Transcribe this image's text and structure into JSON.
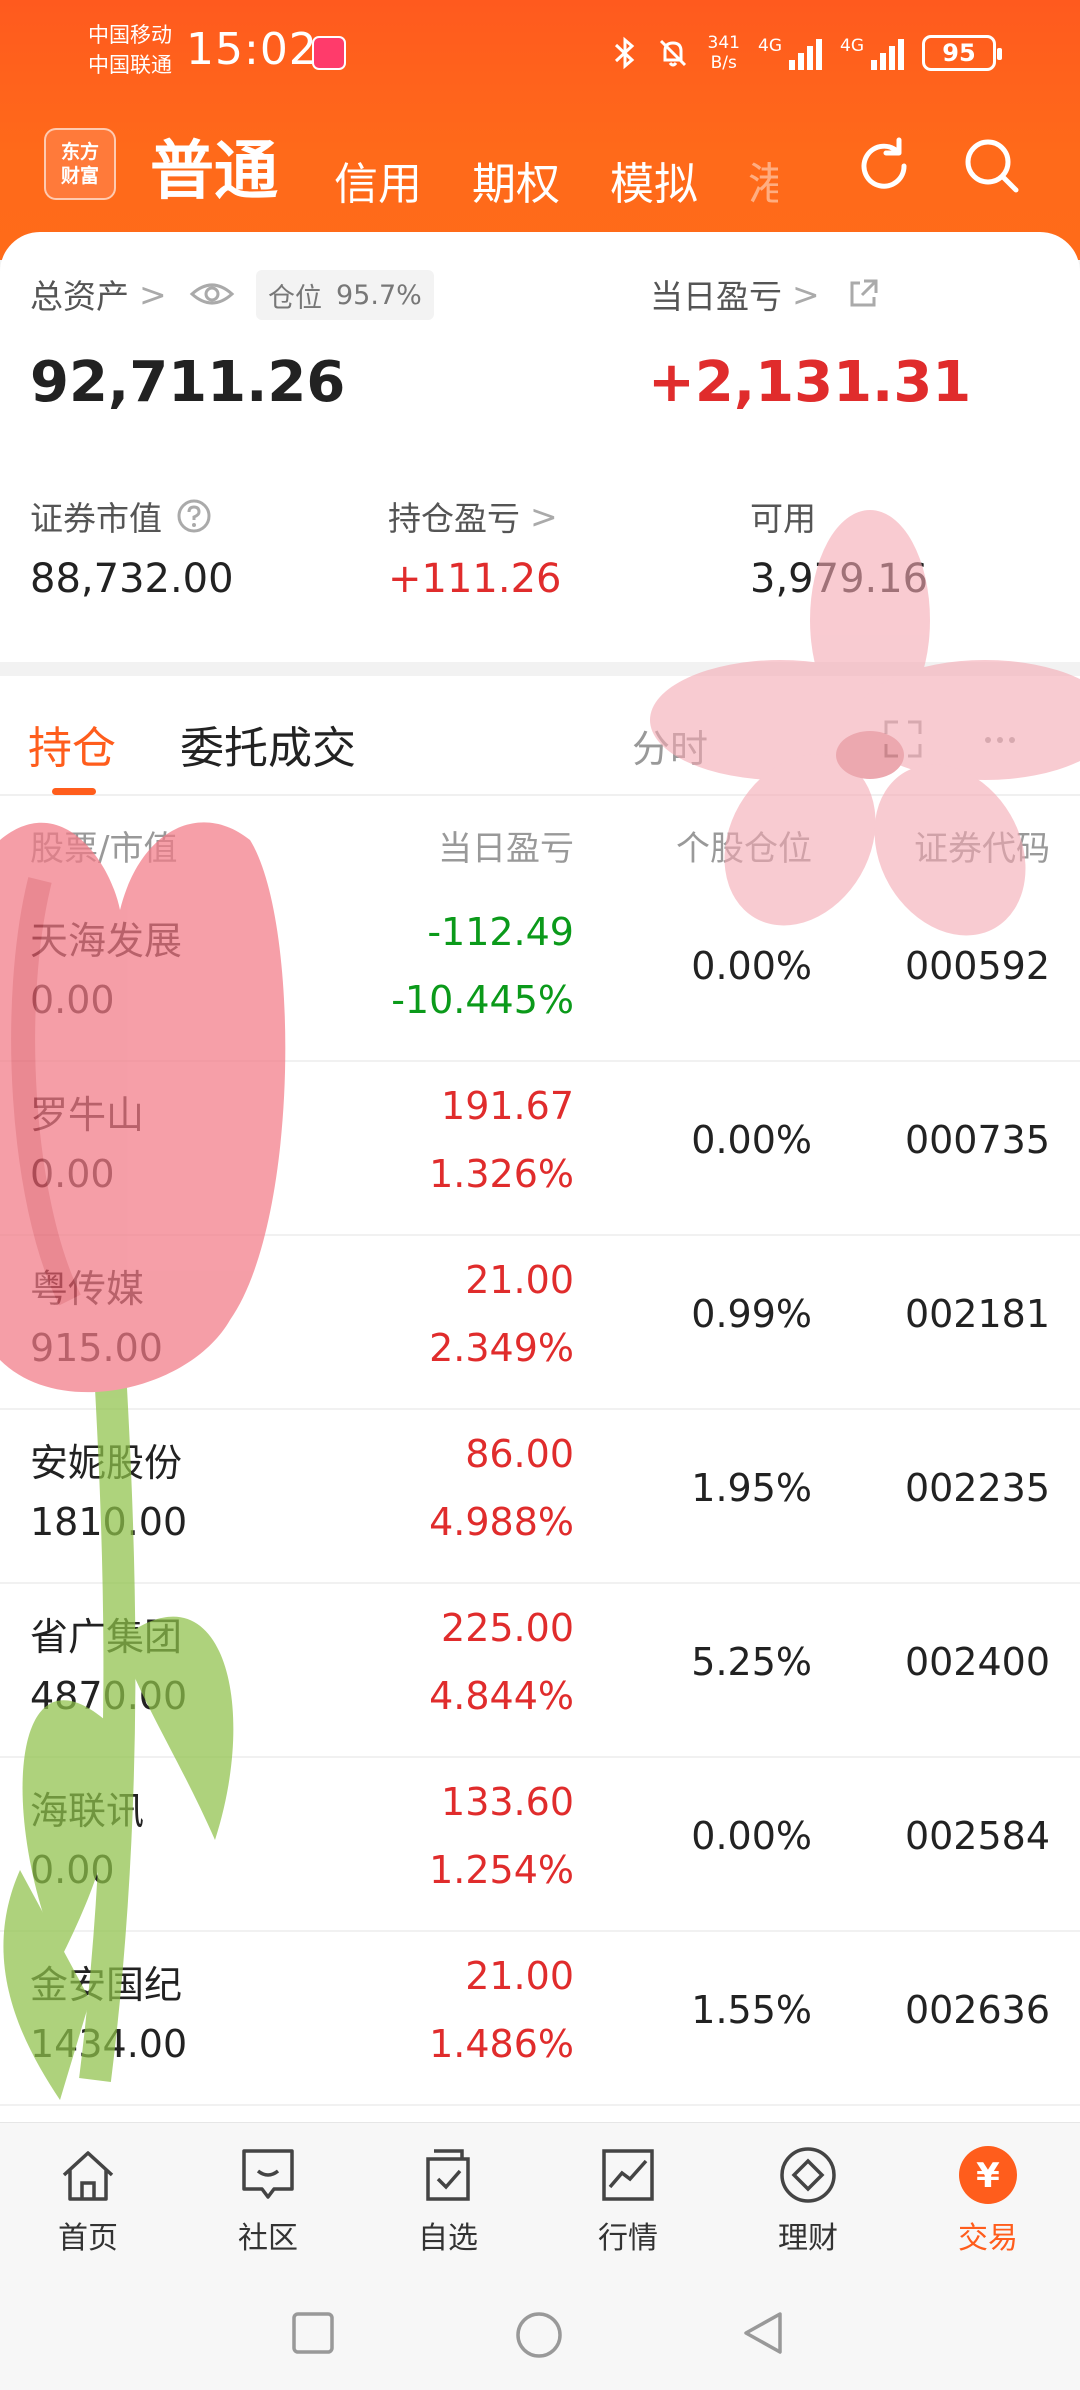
{
  "status_bar": {
    "carrier_1": "中国移动",
    "carrier_2": "中国联通",
    "time": "15:02",
    "net_speed_value": "341",
    "net_speed_unit": "B/s",
    "sig_label_1": "4G",
    "sig_label_2": "4G",
    "battery": "95"
  },
  "top_nav": {
    "logo_line1": "东方",
    "logo_line2": "财富",
    "tabs": [
      "普通",
      "信用",
      "期权",
      "模拟",
      "港"
    ],
    "accent": "#ff5d1c"
  },
  "summary": {
    "total_assets_label": "总资产",
    "position_label": "仓位",
    "position_value": "95.7%",
    "total_assets": "92,711.26",
    "daily_pnl_label": "当日盈亏",
    "daily_pnl": "+2,131.31",
    "market_value_label": "证券市值",
    "market_value": "88,732.00",
    "holding_pnl_label": "持仓盈亏",
    "holding_pnl": "+111.26",
    "available_label": "可用",
    "available": "3,979.16"
  },
  "holdings": {
    "tabs": [
      "持仓",
      "委托成交",
      "分时"
    ],
    "columns": [
      "股票/市值",
      "当日盈亏",
      "个股仓位",
      "证券代码"
    ],
    "rows": [
      {
        "name": "天海发展",
        "market_value": "0.00",
        "pnl": "-112.49",
        "pct": "-10.445%",
        "ratio": "0.00%",
        "code": "000592",
        "direction": "down"
      },
      {
        "name": "罗牛山",
        "market_value": "0.00",
        "pnl": "191.67",
        "pct": "1.326%",
        "ratio": "0.00%",
        "code": "000735",
        "direction": "up"
      },
      {
        "name": "粤传媒",
        "market_value": "915.00",
        "pnl": "21.00",
        "pct": "2.349%",
        "ratio": "0.99%",
        "code": "002181",
        "direction": "up"
      },
      {
        "name": "安妮股份",
        "market_value": "1810.00",
        "pnl": "86.00",
        "pct": "4.988%",
        "ratio": "1.95%",
        "code": "002235",
        "direction": "up"
      },
      {
        "name": "省广集团",
        "market_value": "4870.00",
        "pnl": "225.00",
        "pct": "4.844%",
        "ratio": "5.25%",
        "code": "002400",
        "direction": "up"
      },
      {
        "name": "海联讯",
        "market_value": "0.00",
        "pnl": "133.60",
        "pct": "1.254%",
        "ratio": "0.00%",
        "code": "002584",
        "direction": "up"
      },
      {
        "name": "金安国纪",
        "market_value": "1434.00",
        "pnl": "21.00",
        "pct": "1.486%",
        "ratio": "1.55%",
        "code": "002636",
        "direction": "up"
      }
    ]
  },
  "bottom_nav": {
    "items": [
      "首页",
      "社区",
      "自选",
      "行情",
      "理财",
      "交易"
    ],
    "trade_glyph": "¥"
  },
  "colors": {
    "up": "#e02c2c",
    "down": "#0b9a1a",
    "header": "#ff6a1a"
  }
}
